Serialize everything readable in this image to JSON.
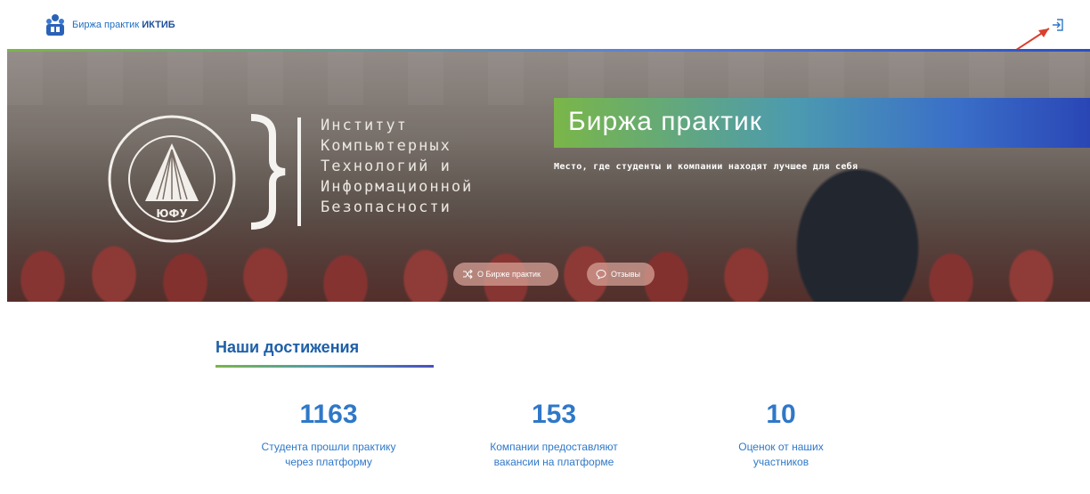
{
  "header": {
    "brand_prefix": "Биржа практик",
    "brand_strong": "ИКТИБ",
    "login_icon": "login-icon",
    "annotation": "red-arrow-pointing-to-login"
  },
  "hero": {
    "institute_lines": [
      "Институт",
      "Компьютерных",
      "Технологий и",
      "Информационной",
      "Безопасности"
    ],
    "seal_text": "ЮФУ",
    "title": "Биржа практик",
    "subtitle": "Место, где студенты и компании находят лучшее для себя",
    "buttons": {
      "about_label": "О Бирже практик",
      "reviews_label": "Отзывы"
    }
  },
  "achievements": {
    "title": "Наши достижения",
    "stats": [
      {
        "value": "1163",
        "label_line1": "Студента прошли практику",
        "label_line2": "через платформу"
      },
      {
        "value": "153",
        "label_line1": "Компании предоставляют",
        "label_line2": "вакансии на платформе"
      },
      {
        "value": "10",
        "label_line1": "Оценок от наших",
        "label_line2": "участников"
      }
    ]
  },
  "colors": {
    "accent_blue": "#2f78c8",
    "heading_blue": "#1e5fa8",
    "gradient_green": "#7ab648",
    "gradient_blue": "#2a46b5",
    "annotation_red": "#d9402f"
  }
}
